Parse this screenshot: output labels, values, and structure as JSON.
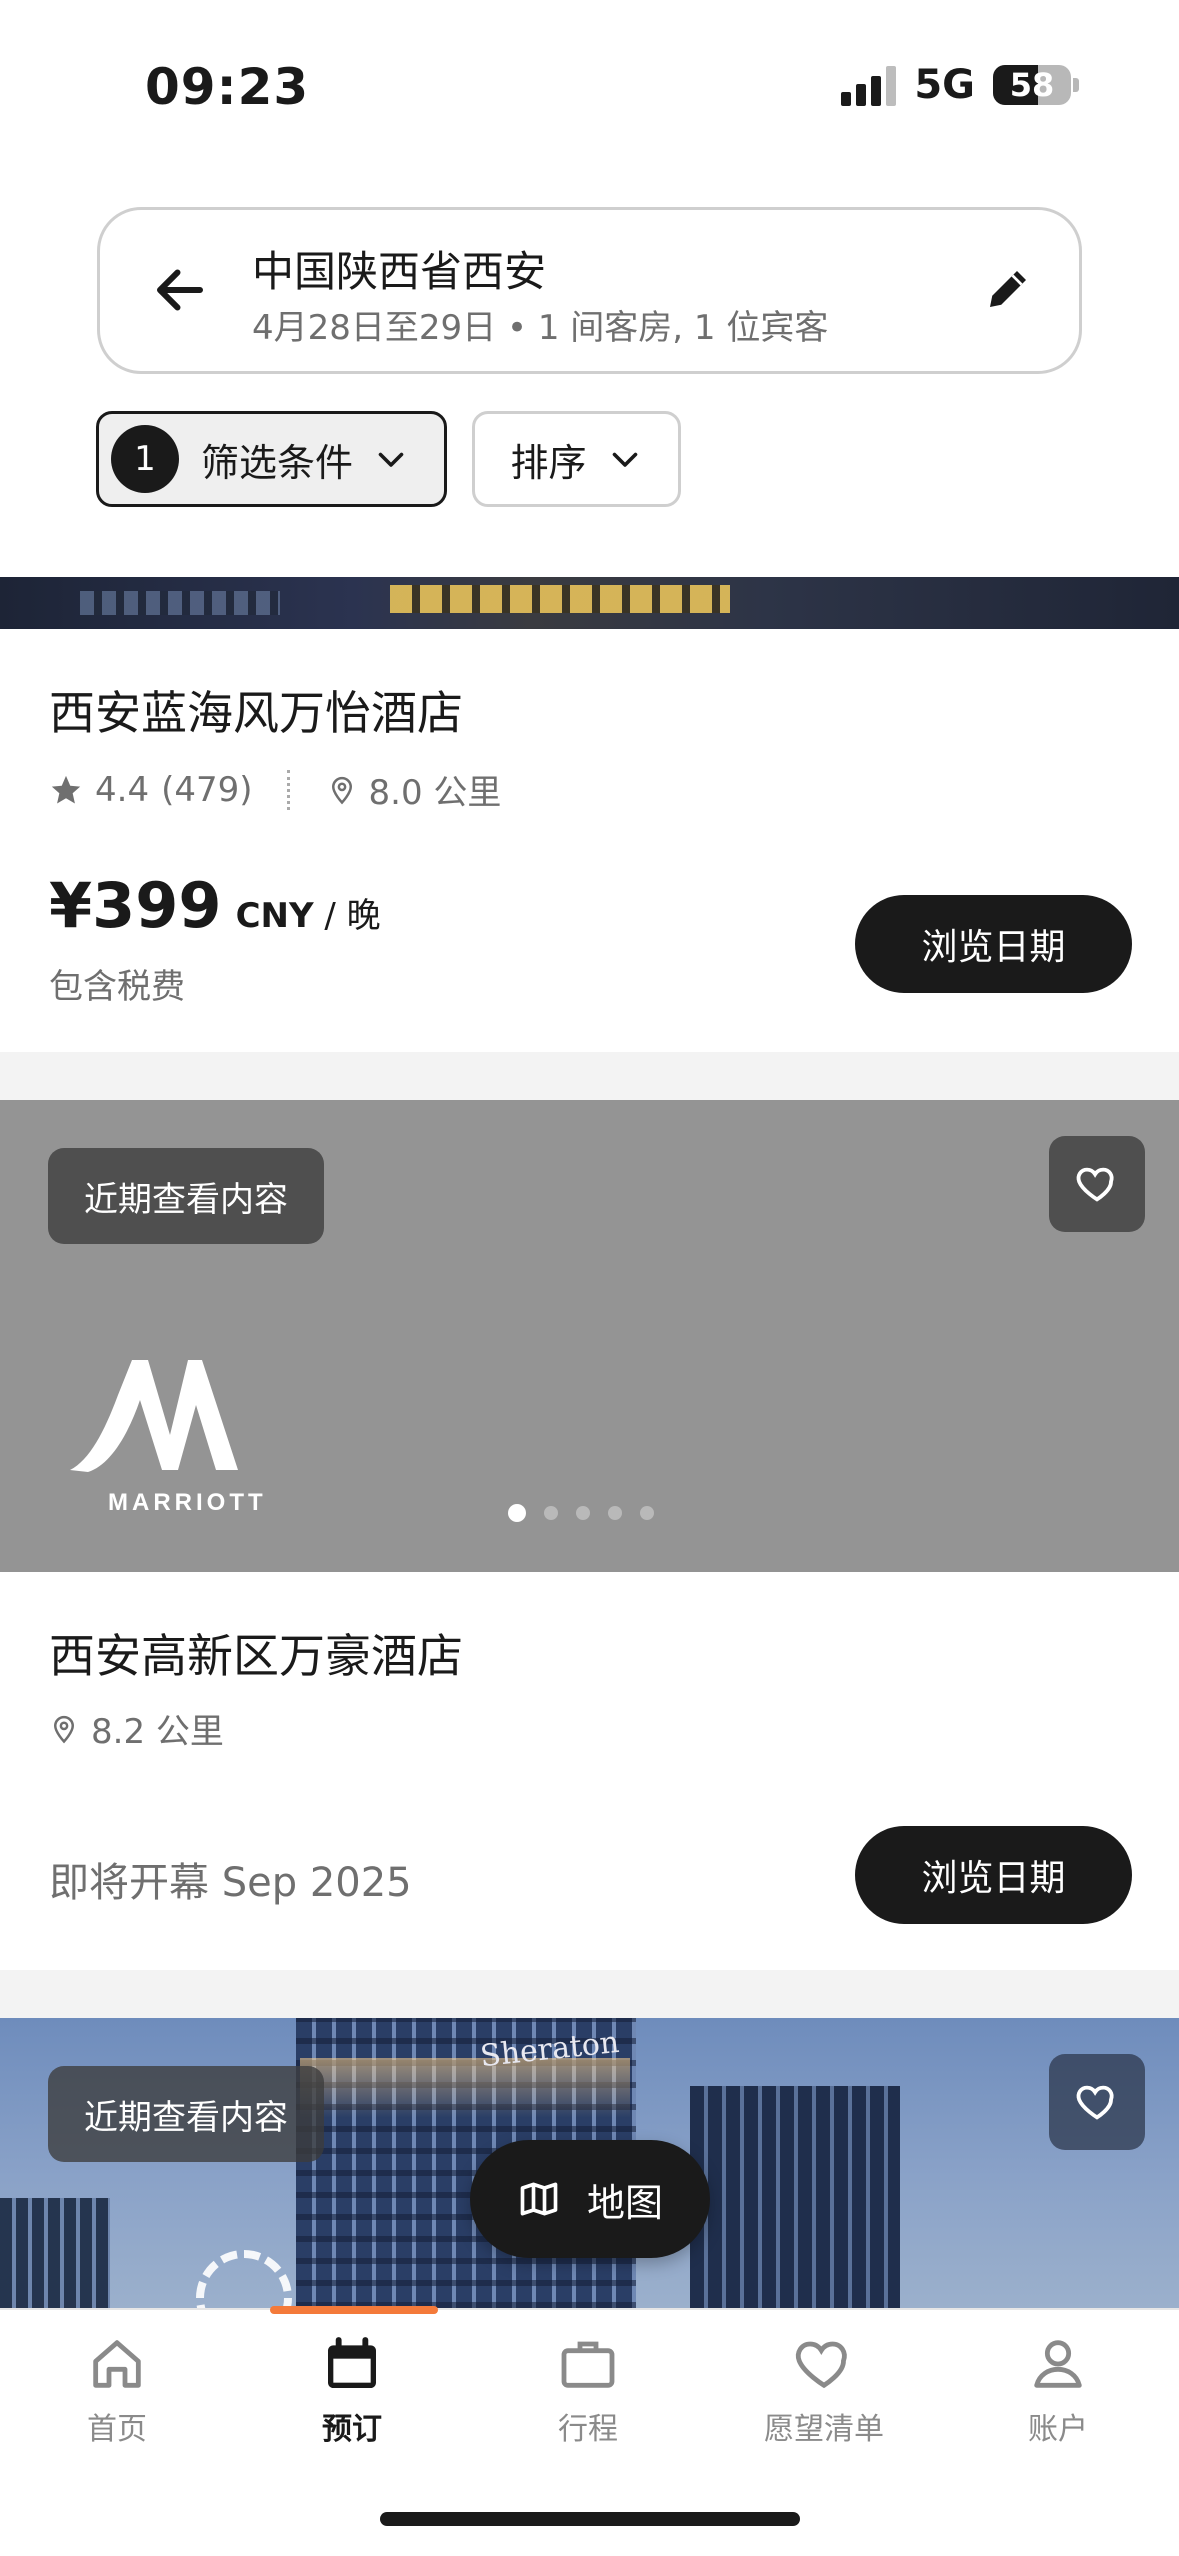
{
  "status_bar": {
    "time": "09:23",
    "network": "5G",
    "battery_level": 58,
    "battery_text": "58"
  },
  "search": {
    "location": "中国陕西省西安",
    "details": "4月28日至29日 • 1 间客房, 1 位宾客"
  },
  "filters": {
    "filter_count": "1",
    "filter_label": "筛选条件",
    "sort_label": "排序"
  },
  "hotels": [
    {
      "name": "西安蓝海风万怡酒店",
      "rating": "4.4",
      "reviews": "(479)",
      "distance": "8.0 公里",
      "price": "¥399",
      "currency": "CNY",
      "per_night": "/ 晚",
      "tax_note": "包含税费",
      "button": "浏览日期"
    },
    {
      "badge": "近期查看内容",
      "logo_text": "MARRIOTT",
      "name": "西安高新区万豪酒店",
      "distance": "8.2 公里",
      "opening": "即将开幕 Sep 2025",
      "button": "浏览日期",
      "carousel": {
        "total": 5,
        "active": 1
      }
    },
    {
      "badge": "近期查看内容",
      "sign_text": "Sheraton"
    }
  ],
  "map_button": "地图",
  "tabs": [
    {
      "label": "首页",
      "icon": "home-icon"
    },
    {
      "label": "预订",
      "icon": "calendar-icon",
      "active": true
    },
    {
      "label": "行程",
      "icon": "briefcase-icon"
    },
    {
      "label": "愿望清单",
      "icon": "heart-icon"
    },
    {
      "label": "账户",
      "icon": "person-icon"
    }
  ],
  "colors": {
    "accent": "#f47a3a",
    "primary": "#1a1a1a",
    "muted": "#6f6f6f"
  }
}
